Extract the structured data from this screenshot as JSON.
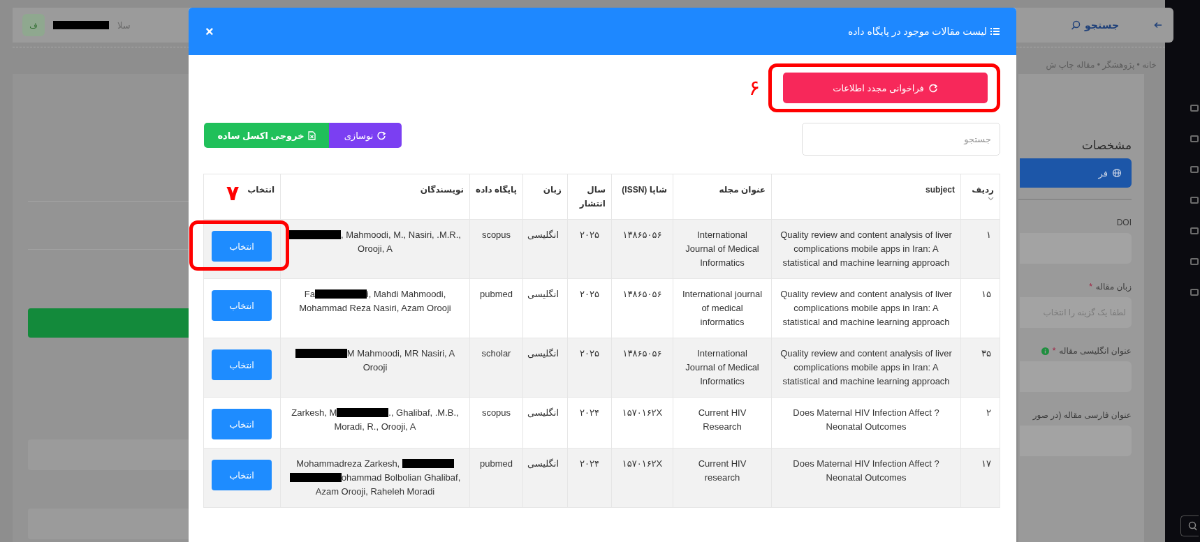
{
  "page": {
    "top_bar": {
      "avatar_letter": "ف",
      "greeting": "سلا",
      "search_label": "جستجو"
    },
    "breadcrumb": "خانه • پژوهشگر • مقاله چاپ ش",
    "form": {
      "section_title": "مشخصات",
      "fetch_button": "فر",
      "fields": [
        {
          "label": "DOI"
        },
        {
          "label": "زبان مقاله",
          "mark": "*",
          "placeholder": "لطفا یک گزینه را انتخاب"
        },
        {
          "label": "عنوان انگلیسی مقاله",
          "mark": "*",
          "info": true
        },
        {
          "label": "عنوان فارسی مقاله (در صور"
        }
      ]
    }
  },
  "modal": {
    "title": "لیست مقالات موجود در پایگاه داده",
    "close": "×",
    "refresh_button": {
      "label": "فراخوانی مجدد اطلاعات",
      "highlighted": true,
      "callout": "۶"
    },
    "search": {
      "placeholder": "جستجو"
    },
    "toolbar": [
      {
        "kind": "reload",
        "label": "نوسازی"
      },
      {
        "kind": "excel",
        "label": "خروجی اکسل ساده"
      }
    ],
    "table": {
      "columns": [
        {
          "label": "ردیف",
          "sortable": true
        },
        {
          "label": "subject",
          "sortable": false
        },
        {
          "label": "عنوان مجله",
          "sortable": false
        },
        {
          "label": "شاپا (ISSN)",
          "sortable": false
        },
        {
          "label": "سال انتشار",
          "sortable": false
        },
        {
          "label": "زبان",
          "sortable": false
        },
        {
          "label": "پایگاه داده",
          "sortable": false
        },
        {
          "label": "نویسندگان",
          "sortable": false
        },
        {
          "label": "انتخاب",
          "sortable": false,
          "callout": "۷"
        }
      ],
      "rows": [
        {
          "number": "۱",
          "subject": "Quality review and content analysis of liver complications mobile apps in Iran: A statistical and machine learning approach",
          "journal": "International Journal of Medical Informatics",
          "issn": "۱۳۸۶۵۰۵۶",
          "year": "۲۰۲۵",
          "language": "انگلیسی",
          "database": "scopus",
          "authors": [
            {
              "kind": "redacted"
            },
            {
              "kind": "text",
              "text": ", Mahmoodi, M., Nasiri, .M.R., Orooji, A"
            }
          ],
          "action": "انتخاب",
          "highlighted": true
        },
        {
          "number": "۱۵",
          "subject": "Quality review and content analysis of liver complications mobile apps in Iran: A statistical and machine learning approach",
          "journal": "International journal of medical informatics",
          "issn": "۱۳۸۶۵۰۵۶",
          "year": "۲۰۲۵",
          "language": "انگلیسی",
          "database": "pubmed",
          "authors": [
            {
              "kind": "text",
              "text": "Fa"
            },
            {
              "kind": "redacted"
            },
            {
              "kind": "text",
              "text": "i, Mahdi Mahmoodi, Mohammad Reza Nasiri, Azam Orooji"
            }
          ],
          "action": "انتخاب",
          "highlighted": false
        },
        {
          "number": "۳۵",
          "subject": "Quality review and content analysis of liver complications mobile apps in Iran: A statistical and machine learning approach",
          "journal": "International Journal of Medical Informatics",
          "issn": "۱۳۸۶۵۰۵۶",
          "year": "۲۰۲۵",
          "language": "انگلیسی",
          "database": "scholar",
          "authors": [
            {
              "kind": "redacted"
            },
            {
              "kind": "text",
              "text": "M Mahmoodi, MR Nasiri, A Orooji"
            }
          ],
          "action": "انتخاب",
          "highlighted": false
        },
        {
          "number": "۲",
          "subject": "Does Maternal HIV Infection Affect ?Neonatal Outcomes",
          "journal": "Current HIV Research",
          "issn": "۱۵۷۰۱۶۲X",
          "year": "۲۰۲۴",
          "language": "انگلیسی",
          "database": "scopus",
          "authors": [
            {
              "kind": "text",
              "text": "Zarkesh, M"
            },
            {
              "kind": "redacted"
            },
            {
              "kind": "text",
              "text": "., Ghalibaf, .M.B., Moradi, R., Orooji, A"
            }
          ],
          "action": "انتخاب",
          "highlighted": false
        },
        {
          "number": "۱۷",
          "subject": "Does Maternal HIV Infection Affect ?Neonatal Outcomes",
          "journal": "Current HIV research",
          "issn": "۱۵۷۰۱۶۲X",
          "year": "۲۰۲۴",
          "language": "انگلیسی",
          "database": "pubmed",
          "authors": [
            {
              "kind": "text",
              "text": "Mohammadreza Zarkesh, "
            },
            {
              "kind": "redacted"
            },
            {
              "kind": "redacted"
            },
            {
              "kind": "text",
              "text": "ohammad Bolbolian Ghalibaf, Azam Orooji, Raheleh Moradi"
            }
          ],
          "action": "انتخاب",
          "highlighted": false
        }
      ]
    }
  }
}
